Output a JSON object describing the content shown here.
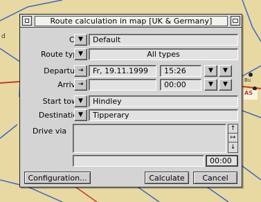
{
  "window": {
    "title": "Route calculation in map [UK & Germany]"
  },
  "form": {
    "car": {
      "label": "Car",
      "value": "Default"
    },
    "route_type": {
      "label": "Route type",
      "value": "All types"
    },
    "departure": {
      "label": "Departure",
      "date": "Fr, 19.11.1999",
      "time": "15:26"
    },
    "arrival": {
      "label": "Arrival",
      "date": "",
      "time": "00:00"
    },
    "start_town": {
      "label": "Start town",
      "value": "Hindley"
    },
    "destination": {
      "label": "Destination",
      "value": "Tipperary"
    },
    "drive_via": {
      "label": "Drive via",
      "duration": "00:00"
    }
  },
  "buttons": {
    "configuration": "Configuration...",
    "calculate": "Calculate",
    "cancel": "Cancel"
  },
  "icons": {
    "menu_arrow": "▼",
    "set_arrow": "⇥",
    "scroll_up": "↑",
    "scroll_right": "↦",
    "scroll_down": "↓"
  },
  "map_labels": {
    "a": "Bu",
    "b": "AS",
    "c": "d"
  },
  "colors": {
    "map_bg": "#e8d9a2",
    "road_blue": "#3a66c9",
    "road_red": "#c23a2a",
    "window_bg": "#d4d4d4"
  }
}
